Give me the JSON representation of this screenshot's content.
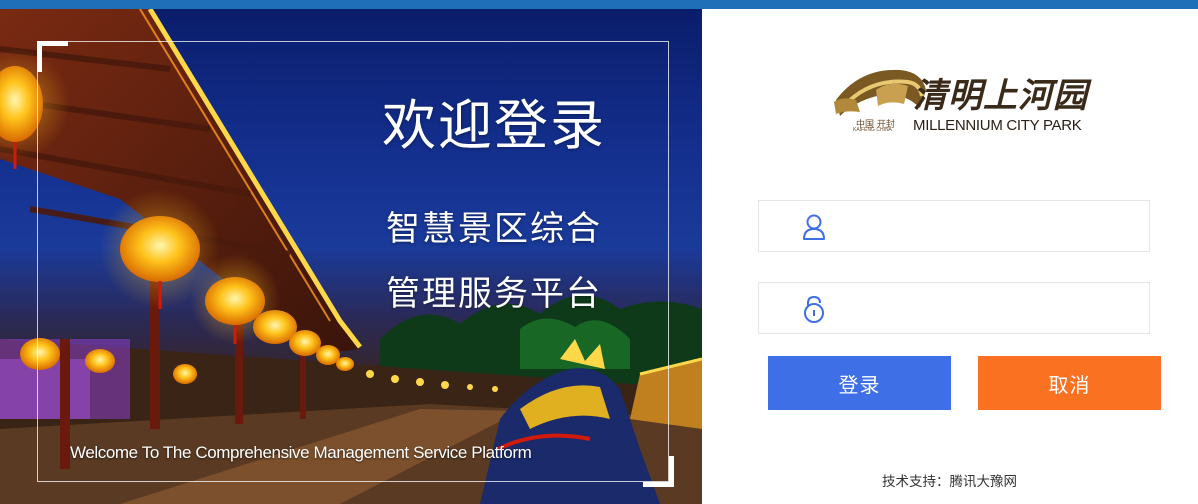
{
  "colors": {
    "accent_blue": "#3e6fe6",
    "cancel_orange": "#fa7221",
    "topbar": "#1f6fb8",
    "icon_blue": "#3e6fe6"
  },
  "hero": {
    "title": "欢迎登录",
    "subtitle_line1": "智慧景区综合",
    "subtitle_line2": "管理服务平台",
    "welcome_en": "Welcome To The Comprehensive Management Service Platform"
  },
  "logo": {
    "name_cn": "清明上河园",
    "small_cn": "中国 开封",
    "small_en": "KAIFENG CHINA",
    "name_en": "MILLENNIUM CITY PARK"
  },
  "form": {
    "username": {
      "icon": "user-icon",
      "value": "",
      "placeholder": ""
    },
    "password": {
      "icon": "lock-icon",
      "value": "",
      "placeholder": ""
    },
    "login_label": "登录",
    "cancel_label": "取消"
  },
  "footer": {
    "support": "技术支持：腾讯大豫网"
  }
}
